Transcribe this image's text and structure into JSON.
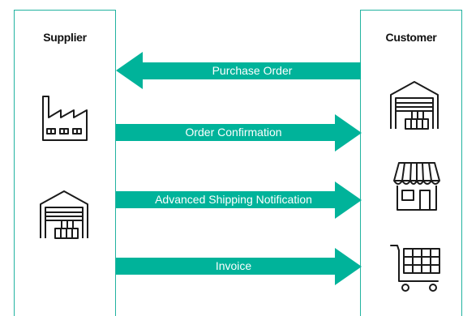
{
  "colors": {
    "accent": "#00b39a",
    "lane_border": "#22b3a0",
    "icon_stroke": "#1a1a1a",
    "label_text": "#ffffff"
  },
  "lanes": {
    "supplier": {
      "title": "Supplier",
      "icons": [
        "factory-icon",
        "warehouse-icon"
      ]
    },
    "customer": {
      "title": "Customer",
      "icons": [
        "warehouse-icon",
        "store-icon",
        "shopping-cart-icon"
      ]
    }
  },
  "messages": [
    {
      "label": "Purchase Order",
      "direction": "to-supplier"
    },
    {
      "label": "Order Confirmation",
      "direction": "to-customer"
    },
    {
      "label": "Advanced Shipping Notification",
      "direction": "to-customer"
    },
    {
      "label": "Invoice",
      "direction": "to-customer"
    }
  ]
}
